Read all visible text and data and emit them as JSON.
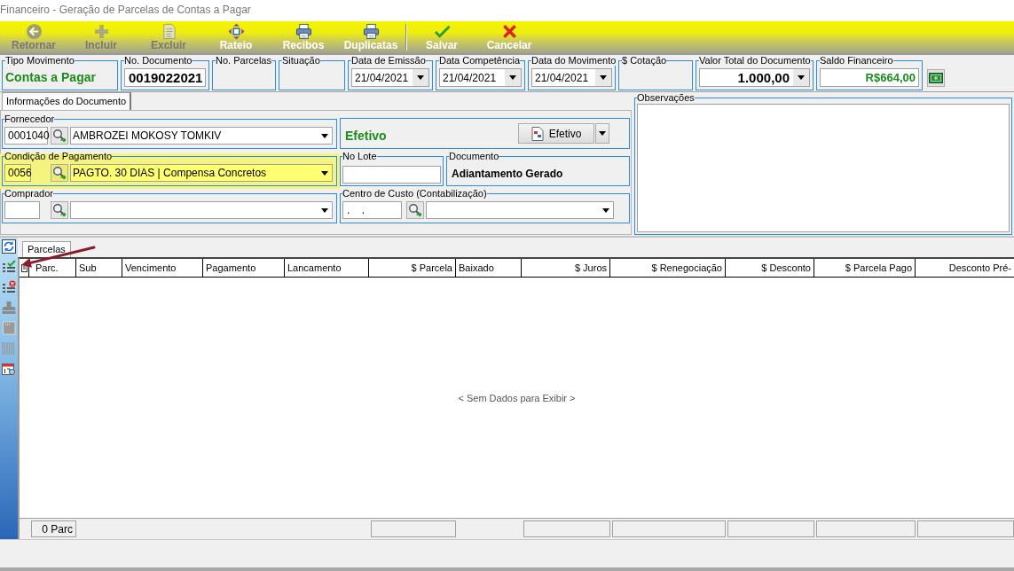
{
  "window": {
    "title": "Financeiro - Geração de Parcelas de Contas a Pagar"
  },
  "toolbar_groups": [
    {
      "buttons": [
        {
          "label": "Retornar",
          "kind": "back",
          "disabled": true
        },
        {
          "label": "Incluir",
          "kind": "add",
          "disabled": true
        },
        {
          "label": "Excluir",
          "kind": "delete",
          "disabled": true
        },
        {
          "label": "Rateio",
          "kind": "split",
          "disabled": false
        },
        {
          "label": "Recibos",
          "kind": "receipts",
          "disabled": false
        },
        {
          "label": "Duplicatas",
          "kind": "duplicates",
          "disabled": false
        }
      ]
    },
    {
      "buttons": [
        {
          "label": "Salvar",
          "kind": "save",
          "disabled": false
        },
        {
          "label": "Cancelar",
          "kind": "cancel",
          "disabled": false
        }
      ]
    }
  ],
  "header_fields": [
    {
      "label": "Tipo Movimento",
      "kind": "text",
      "value": "Contas a Pagar"
    },
    {
      "label": "No. Documento",
      "kind": "input",
      "value": "0019022021"
    },
    {
      "label": "No. Parcelas",
      "kind": "empty"
    },
    {
      "label": "Situação",
      "kind": "empty"
    },
    {
      "label": "Data de Emissão",
      "kind": "date",
      "value": "21/04/2021"
    },
    {
      "label": "Data Competência",
      "kind": "date",
      "value": "21/04/2021"
    },
    {
      "label": "Data do Movimento",
      "kind": "date",
      "value": "21/04/2021"
    },
    {
      "label": "$ Cotação",
      "kind": "empty"
    }
  ],
  "totals": [
    {
      "label": "Valor Total do Documento",
      "kind": "total",
      "value": "1.000,00"
    },
    {
      "label": "Saldo Financeiro",
      "kind": "amount",
      "value": "R$664,00"
    }
  ],
  "document_tabs": [
    {
      "label": "Informações do Documento",
      "selected": true
    }
  ],
  "form": {
    "rows": [
      {
        "groups": [
          {
            "label": "Fornecedor",
            "kind": "lookup",
            "code": "0001040",
            "value": "AMBROZEI MOKOSY TOMKIV",
            "highlighted": false
          },
          {
            "kind": "status",
            "value": "Efetivo",
            "button": "Efetivo",
            "highlighted": false
          }
        ]
      },
      {
        "groups": [
          {
            "label": "Condição de Pagamento",
            "kind": "lookup",
            "code": "0056",
            "value": "PAGTO. 30 DIAS | Compensa Concretos",
            "highlighted": true
          },
          {
            "label": "No Lote",
            "kind": "input",
            "highlighted": false
          },
          {
            "label": "Documento",
            "kind": "text",
            "value": "Adiantamento Gerado",
            "highlighted": false
          }
        ]
      },
      {
        "groups": [
          {
            "label": "Comprador",
            "kind": "lookup",
            "highlighted": false
          },
          {
            "label": "Centro de Custo (Contabilização)",
            "kind": "lookup",
            "code": ". .",
            "highlighted": false
          }
        ]
      }
    ]
  },
  "observations": {
    "label": "Observações"
  },
  "grid_tabs": [
    {
      "label": "Parcelas",
      "selected": true
    }
  ],
  "table": {
    "columns": [
      {
        "label": "Parc.",
        "kind": "text",
        "footer_box": true,
        "footer": "0 Parc"
      },
      {
        "label": "Sub",
        "kind": "text",
        "footer_box": false
      },
      {
        "label": "Vencimento",
        "kind": "text",
        "footer_box": false
      },
      {
        "label": "Pagamento",
        "kind": "text",
        "footer_box": false
      },
      {
        "label": "Lancamento",
        "kind": "text",
        "footer_box": false
      },
      {
        "label": "$ Parcela",
        "kind": "money",
        "footer_box": true
      },
      {
        "label": "Baixado",
        "kind": "text",
        "footer_box": false
      },
      {
        "label": "$ Juros",
        "kind": "money",
        "footer_box": true
      },
      {
        "label": "$ Renegociação",
        "kind": "money",
        "footer_box": true
      },
      {
        "label": "$ Desconto",
        "kind": "money",
        "footer_box": true
      },
      {
        "label": "$ Parcela Pago",
        "kind": "money",
        "footer_box": true
      },
      {
        "label": "Desconto Pré-",
        "kind": "money",
        "footer_box": true
      }
    ],
    "empty_message": "< Sem Dados para Exibir >"
  }
}
